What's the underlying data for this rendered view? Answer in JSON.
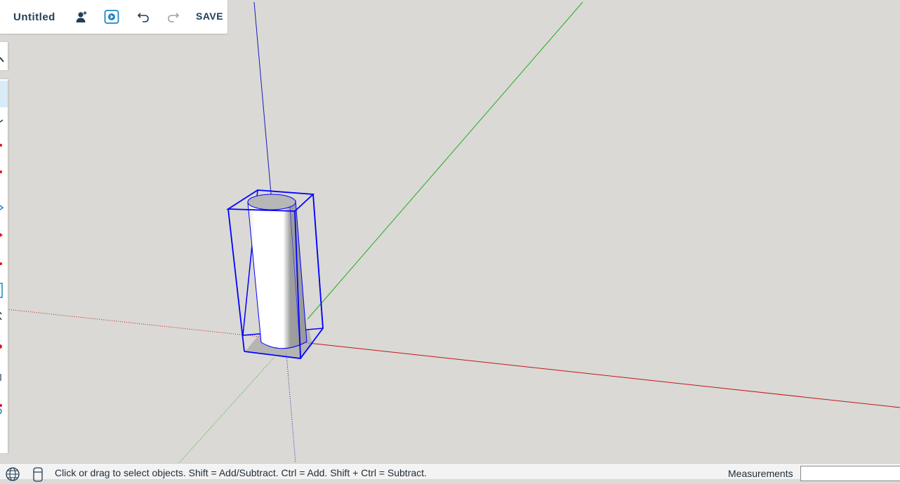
{
  "app": {
    "title": "Untitled",
    "save_label": "SAVE"
  },
  "toolbar": {
    "icons": [
      "add-collaborator-icon",
      "present-icon",
      "undo-icon",
      "redo-icon"
    ]
  },
  "status_bar": {
    "hint": "Click or drag to select objects. Shift = Add/Subtract. Ctrl = Add. Shift + Ctrl = Subtract.",
    "measurements_label": "Measurements",
    "measurements_value": "",
    "icons": [
      "globe-icon",
      "mouse-icon"
    ]
  },
  "colors": {
    "accent": "#213e55",
    "selection": "#0000ff",
    "axis_red": "#c00000",
    "axis_green": "#00b000",
    "axis_blue": "#0000c0",
    "viewport_bg": "#dad9d5"
  }
}
